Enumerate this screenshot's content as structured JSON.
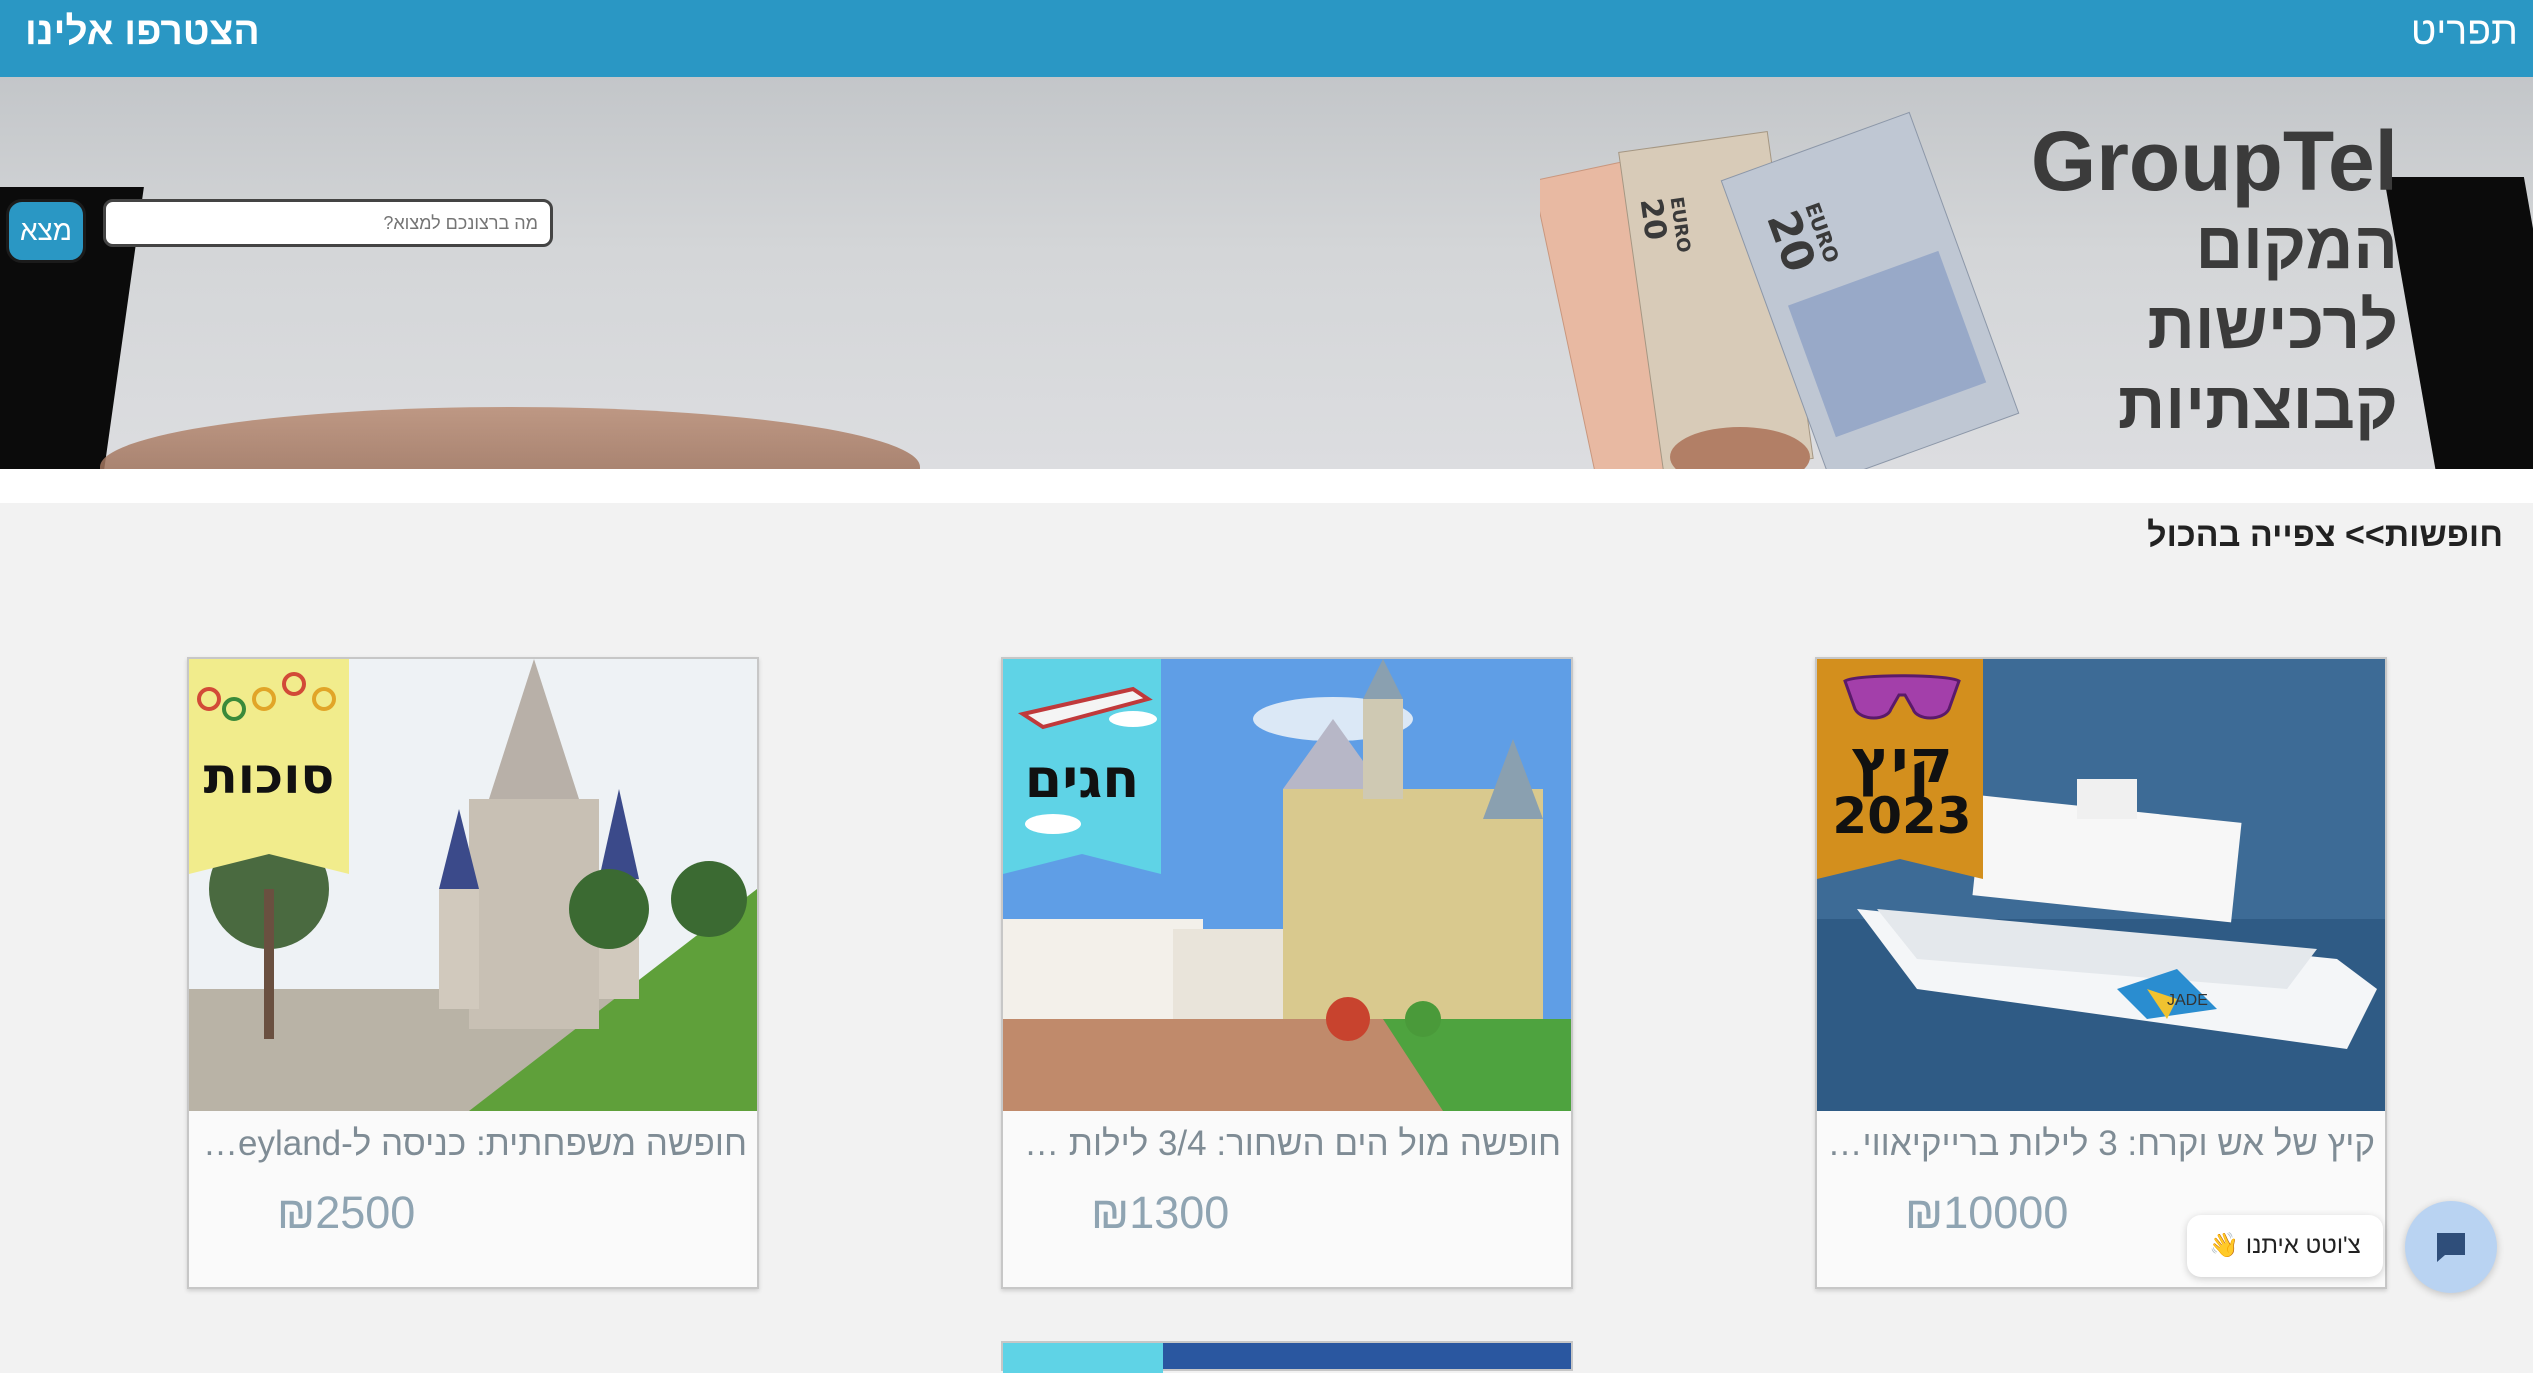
{
  "topbar": {
    "menu": "תפריט",
    "join": "הצטרפו אלינו"
  },
  "hero": {
    "brand_name": "GroupTel",
    "tagline_lines": [
      "המקום",
      "לרכישות",
      "קבוצתיות"
    ],
    "banknote_labels": [
      "20",
      "EURO",
      "20",
      "EURO"
    ]
  },
  "search": {
    "placeholder": "מה ברצונכם למצוא?",
    "button": "מצא"
  },
  "breadcrumb": {
    "section": "חופשות>>",
    "view_all": "צפייה בהכול"
  },
  "cards": [
    {
      "ribbon": "קיץ 2023",
      "ribbon_line1": "קיץ",
      "ribbon_line2": "2023",
      "ribbon_color": "#d38f1d",
      "title": "קיץ של אש וקרח: 3 לילות ברייקיאוויק ...",
      "price": "₪10000"
    },
    {
      "ribbon": "חגים",
      "ribbon_color": "#5fd3e6",
      "title": "חופשה מול הים השחור: 3/4 לילות במ...",
      "price": "₪1300"
    },
    {
      "ribbon": "סוכות",
      "ribbon_color": "#f1ec8c",
      "title": "חופשה משפחתית: כניסה ל-neyland...",
      "price": "₪2500"
    }
  ],
  "chat": {
    "label": "צ'וטט איתנו 👋",
    "icon": "chat-icon"
  },
  "colors": {
    "primary": "#2a97c4",
    "background": "#f2f2f2"
  }
}
